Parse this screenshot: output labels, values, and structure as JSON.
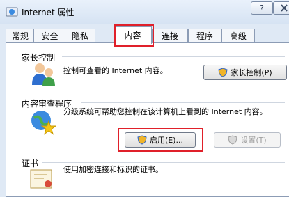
{
  "window": {
    "title": "Internet 属性",
    "help_glyph": "?"
  },
  "tabs": [
    {
      "label": "常规",
      "active": false
    },
    {
      "label": "安全",
      "active": false
    },
    {
      "label": "隐私",
      "active": false
    },
    {
      "label": "内容",
      "active": true
    },
    {
      "label": "连接",
      "active": false
    },
    {
      "label": "程序",
      "active": false
    },
    {
      "label": "高级",
      "active": false
    }
  ],
  "parental": {
    "heading": "家长控制",
    "description": "控制可查看的 Internet 内容。",
    "button_label": "家长控制(P)"
  },
  "advisor": {
    "heading": "内容审查程序",
    "description": "分级系统可帮助您控制在该计算机上看到的 Internet 内容。",
    "enable_label": "启用(E)...",
    "settings_label": "设置(T)"
  },
  "certs": {
    "heading": "证书",
    "description": "使用加密连接和标识的证书。"
  },
  "colors": {
    "highlight": "#e0202a",
    "tab_border": "#8c9cb5"
  },
  "icons": [
    "internet-options-icon",
    "help-icon",
    "close-icon",
    "parental-users-icon",
    "globe-star-icon",
    "certificate-icon",
    "shield-icon"
  ]
}
